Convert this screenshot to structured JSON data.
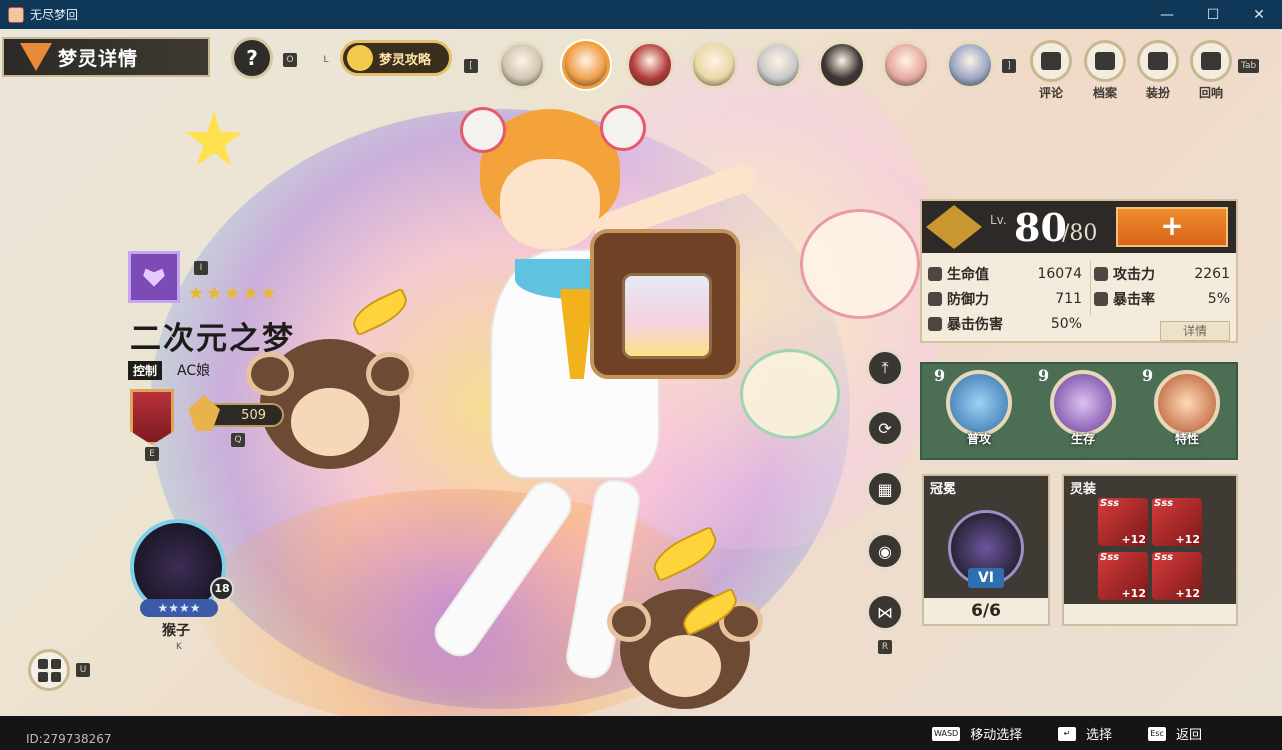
{
  "window": {
    "title": "无尽梦回",
    "controls": {
      "minimize": "—",
      "maximize": "☐",
      "close": "✕"
    }
  },
  "header": {
    "page_title": "梦灵详情",
    "help_icon": "?",
    "help_key": "O",
    "guide_key_left": "L",
    "guide_label": "梦灵攻略",
    "avatars_key_left": "[",
    "avatars_key_right": "]",
    "tab_key": "Tab"
  },
  "avatars": [
    {
      "name": "avatar-1",
      "color": "#cfc6b3"
    },
    {
      "name": "avatar-2",
      "color": "#f0a04a",
      "selected": true
    },
    {
      "name": "avatar-3",
      "color": "#b23a3a"
    },
    {
      "name": "avatar-4",
      "color": "#e9d8a6"
    },
    {
      "name": "avatar-5",
      "color": "#c9c9c9"
    },
    {
      "name": "avatar-6",
      "color": "#3a3433"
    },
    {
      "name": "avatar-7",
      "color": "#e5a9a0"
    },
    {
      "name": "avatar-8",
      "color": "#9aa6c4"
    }
  ],
  "top_menu": [
    {
      "label": "评论",
      "icon": "comment-icon"
    },
    {
      "label": "档案",
      "icon": "archive-icon"
    },
    {
      "label": "装扮",
      "icon": "outfit-icon"
    },
    {
      "label": "回响",
      "icon": "echo-icon"
    }
  ],
  "character": {
    "element_key": "I",
    "stars": "★★★★★",
    "name": "二次元之梦",
    "role": "控制",
    "voice": "AC娘",
    "rank_key": "E",
    "power": "509",
    "power_key": "Q"
  },
  "pet": {
    "level": "18",
    "stars": "★★★★",
    "name": "猴子",
    "key": "K"
  },
  "inventory_key": "U",
  "side_actions": {
    "top_icon": "⤒",
    "swap_icon": "⟳",
    "film_icon": "▦",
    "eye_icon": "◉",
    "share_icon": "⋈",
    "share_key": "R"
  },
  "stats": {
    "lv_label": "Lv.",
    "level": "80",
    "max_level": "/80",
    "upgrade": "+",
    "rows": [
      {
        "name": "生命值",
        "value": "16074"
      },
      {
        "name": "攻击力",
        "value": "2261"
      },
      {
        "name": "防御力",
        "value": "711"
      },
      {
        "name": "暴击率",
        "value": "5%"
      },
      {
        "name": "暴击伤害",
        "value": "50%"
      }
    ],
    "detail": "详情"
  },
  "skills": [
    {
      "level": "9",
      "label": "普攻",
      "color": "#4aa3e6"
    },
    {
      "level": "9",
      "label": "生存",
      "color": "#a86bd6"
    },
    {
      "level": "9",
      "label": "特性",
      "color": "#e07c4a"
    }
  ],
  "crown": {
    "title": "冠冕",
    "roman": "VI",
    "count": "6/6"
  },
  "gear": {
    "title": "灵装",
    "slots": [
      {
        "grade": "Sss",
        "plus": "+12"
      },
      {
        "grade": "Sss",
        "plus": "+12"
      },
      {
        "grade": "Sss",
        "plus": "+12"
      },
      {
        "grade": "Sss",
        "plus": "+12"
      }
    ]
  },
  "footer": {
    "player_id": "ID:279738267",
    "hints": [
      {
        "key": "WASD",
        "label": "移动选择"
      },
      {
        "key": "↵",
        "label": "选择"
      },
      {
        "key": "Esc",
        "label": "返回"
      }
    ]
  }
}
